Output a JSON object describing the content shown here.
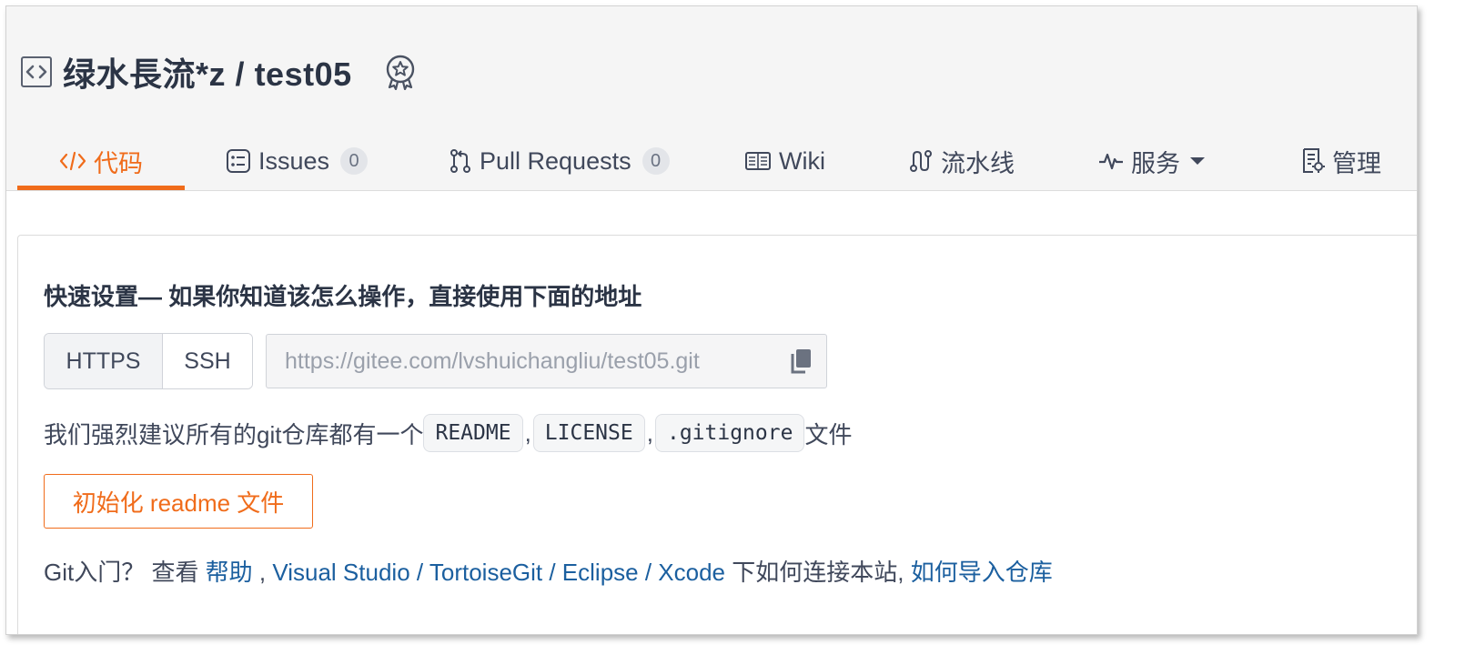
{
  "repo": {
    "owner": "绿水長流*z",
    "separator": "/",
    "name": "test05"
  },
  "tabs": [
    {
      "label": "代码",
      "active": true
    },
    {
      "label": "Issues",
      "count": "0"
    },
    {
      "label": "Pull Requests",
      "count": "0"
    },
    {
      "label": "Wiki"
    },
    {
      "label": "流水线"
    },
    {
      "label": "服务"
    },
    {
      "label": "管理"
    }
  ],
  "setup": {
    "title": "快速设置— 如果你知道该怎么操作，直接使用下面的地址",
    "protocols": [
      "HTTPS",
      "SSH"
    ],
    "url": "https://gitee.com/lvshuichangliu/test05.git",
    "recommend_prefix": "我们强烈建议所有的git仓库都有一个",
    "files": [
      "README",
      "LICENSE",
      ".gitignore"
    ],
    "comma": ",",
    "recommend_suffix": "文件",
    "init_button": "初始化 readme 文件"
  },
  "help": {
    "prefix": "Git入门？ 查看 ",
    "help_link": "帮助",
    "sep1": " , ",
    "vs_link": "Visual Studio",
    "slash": " / ",
    "tortoise_link": "TortoiseGit",
    "eclipse_link": "Eclipse",
    "xcode_link": "Xcode",
    "middle": " 下如何连接本站, ",
    "import_link": "如何导入仓库"
  },
  "colors": {
    "accent": "#f06c1b",
    "link": "#1b5f9f",
    "text": "#40485b"
  },
  "icons": [
    "repo-code-icon",
    "award-badge-icon",
    "code-tab-icon",
    "issues-icon",
    "pull-request-icon",
    "wiki-book-icon",
    "pipeline-icon",
    "pulse-icon",
    "caret-down-icon",
    "manage-doc-icon",
    "copy-icon"
  ]
}
